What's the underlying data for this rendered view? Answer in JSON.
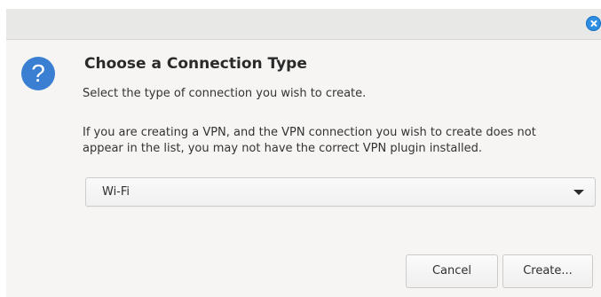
{
  "dialog": {
    "heading": "Choose a Connection Type",
    "subtitle": "Select the type of connection you wish to create.",
    "note_lines": [
      "If you are creating a VPN, and the VPN connection you wish to create does not",
      "appear in the list, you may not have the correct VPN plugin installed."
    ],
    "icon": "question-icon",
    "close_icon": "close-icon"
  },
  "connection_type": {
    "selected": "Wi-Fi"
  },
  "buttons": {
    "cancel_label": "Cancel",
    "create_label": "Create..."
  },
  "colors": {
    "accent": "#2d8ee2",
    "question_icon_bg": "#3a7fd2",
    "window_bg": "#f6f5f4",
    "titlebar_bg": "#e8e8e7"
  }
}
